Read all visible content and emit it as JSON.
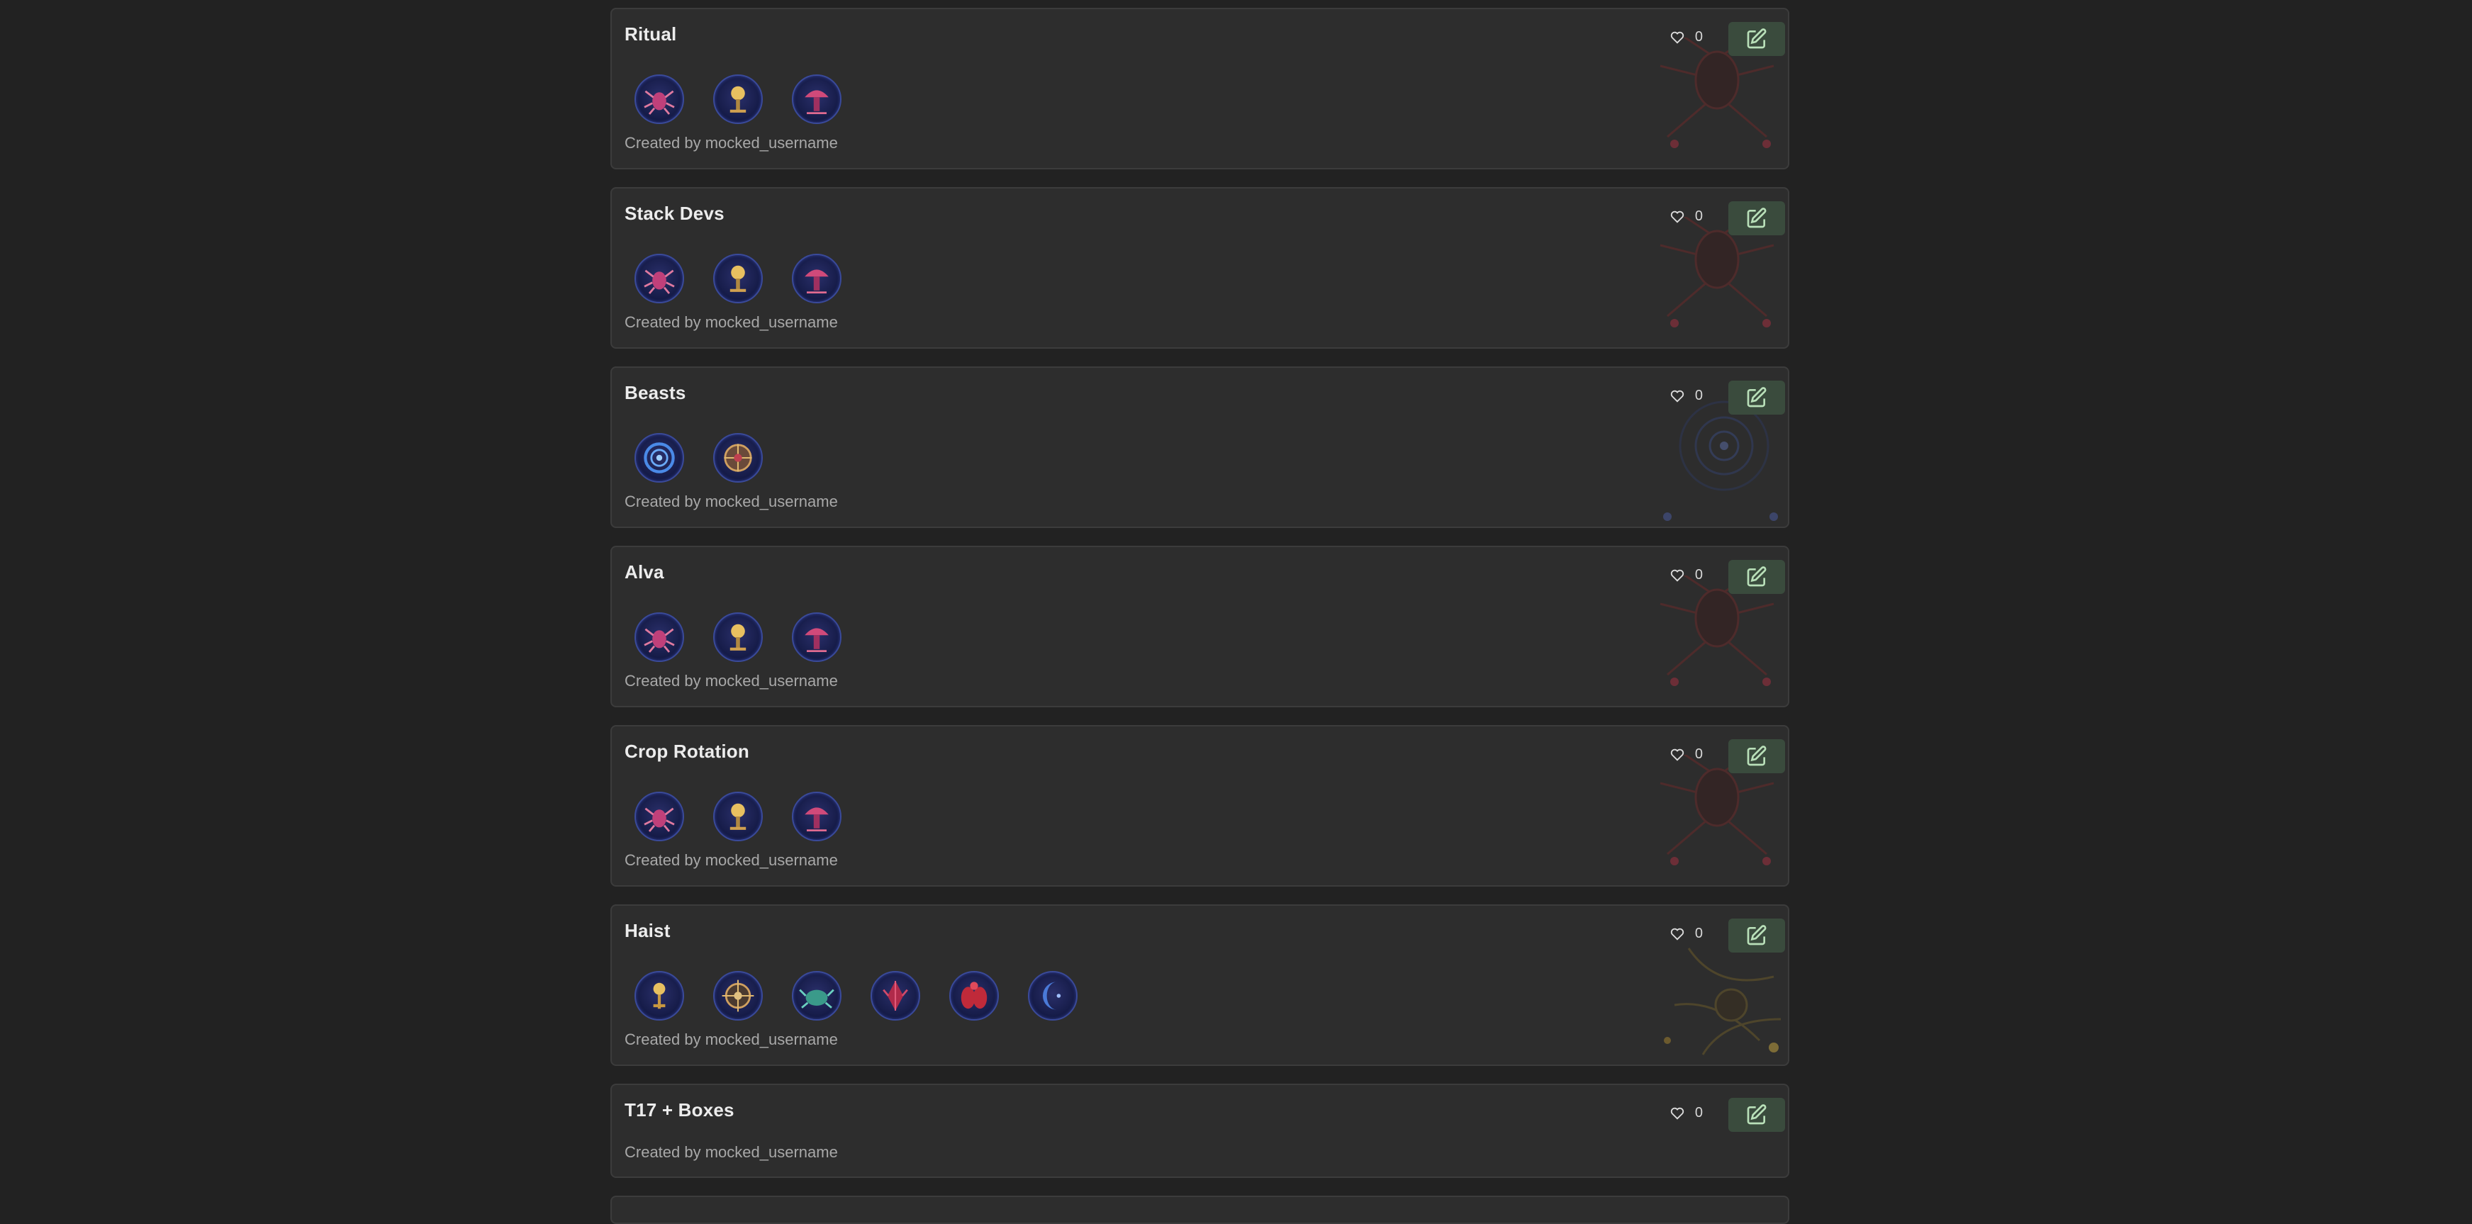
{
  "colors": {
    "page_bg": "#222222",
    "card_bg": "#2d2d2d",
    "card_border": "#3c3c3c",
    "edit_button_bg": "#3a4b3d",
    "edit_icon": "#b9e0b9",
    "scarab_ring": "#3a4a9a"
  },
  "cards": [
    {
      "title": "Ritual",
      "likes": "0",
      "creator": "Created by mocked_username",
      "scarabs": [
        "pink-spider-scarab-icon",
        "gold-bulb-scarab-icon",
        "pink-mushroom-scarab-icon"
      ],
      "background": "red-spider-art"
    },
    {
      "title": "Stack Devs",
      "likes": "0",
      "creator": "Created by mocked_username",
      "scarabs": [
        "pink-spider-scarab-icon",
        "gold-bulb-scarab-icon",
        "pink-mushroom-scarab-icon"
      ],
      "background": "red-spider-art"
    },
    {
      "title": "Beasts",
      "likes": "0",
      "creator": "Created by mocked_username",
      "scarabs": [
        "blue-ring-scarab-icon",
        "gold-compass-scarab-icon"
      ],
      "background": "blue-ring-art"
    },
    {
      "title": "Alva",
      "likes": "0",
      "creator": "Created by mocked_username",
      "scarabs": [
        "pink-spider-scarab-icon",
        "gold-bulb-scarab-icon",
        "pink-mushroom-scarab-icon"
      ],
      "background": "red-spider-art"
    },
    {
      "title": "Crop Rotation",
      "likes": "0",
      "creator": "Created by mocked_username",
      "scarabs": [
        "pink-spider-scarab-icon",
        "gold-bulb-scarab-icon",
        "pink-mushroom-scarab-icon"
      ],
      "background": "red-spider-art"
    },
    {
      "title": "Haist",
      "likes": "0",
      "creator": "Created by mocked_username",
      "scarabs": [
        "gold-key-scarab-icon",
        "gold-compass-scarab-icon",
        "teal-crab-scarab-icon",
        "red-crystal-scarab-icon",
        "red-beetle-scarab-icon",
        "blue-moon-scarab-icon"
      ],
      "background": "gold-web-art"
    },
    {
      "title": "T17 + Boxes",
      "likes": "0",
      "creator": "Created by mocked_username",
      "scarabs": [],
      "background": "none"
    }
  ]
}
